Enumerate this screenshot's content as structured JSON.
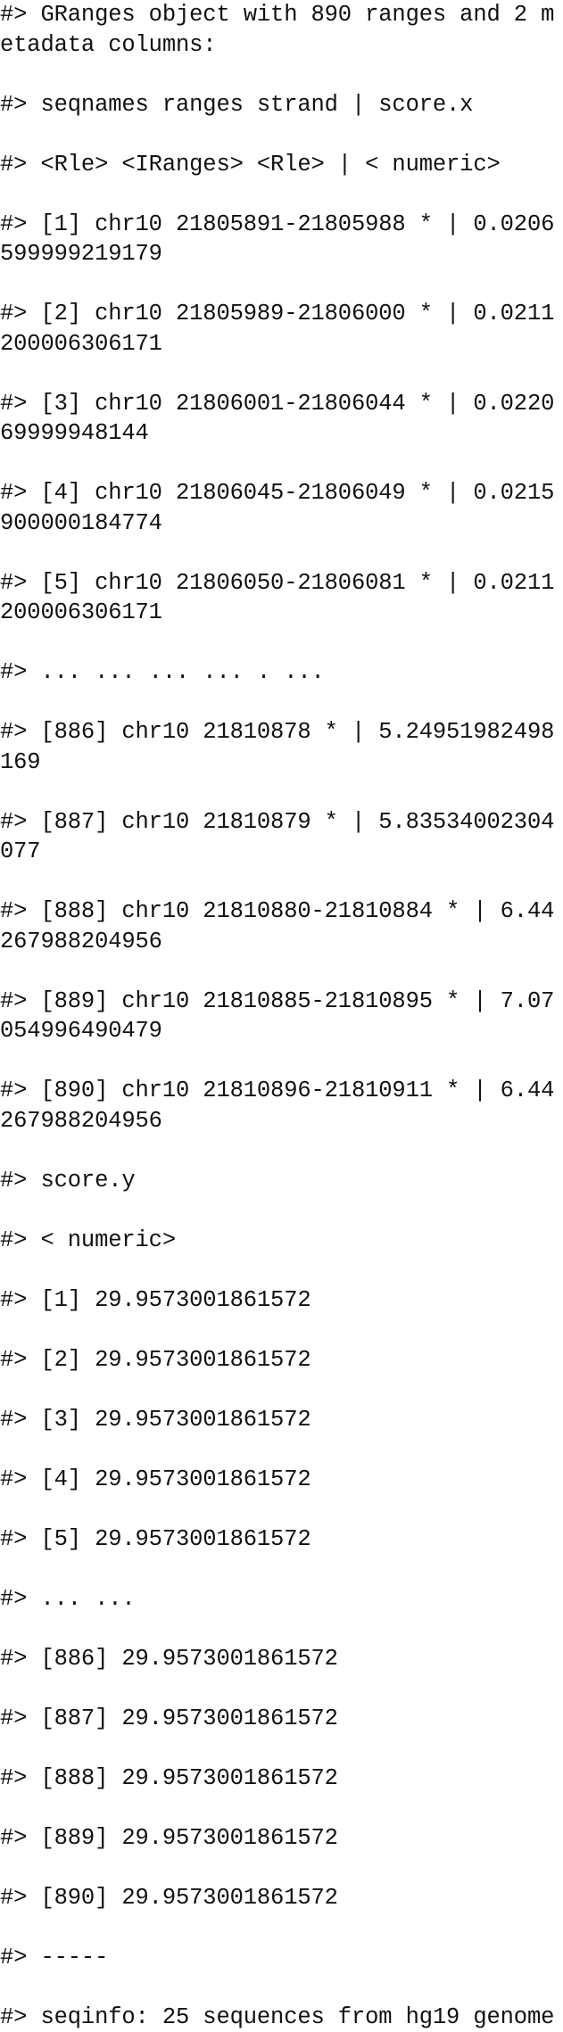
{
  "window": {
    "kind": "r-console-output",
    "background_color": "#ffffff",
    "text_color": "#111111",
    "prompt_prefix": "#>"
  },
  "console": {
    "object_type": "GRanges",
    "n_ranges": 890,
    "n_metadata_columns": 2,
    "genome": "hg19",
    "n_sequences": 25,
    "seqname": "chr10",
    "lines": [
      "#> GRanges object with 890 ranges and 2 metadata columns:",
      "#> seqnames ranges strand | score.x",
      "#> <Rle> <IRanges> <Rle> | < numeric>",
      "#> [1] chr10 21805891-21805988 * | 0.0206599999219179",
      "#> [2] chr10 21805989-21806000 * | 0.0211200006306171",
      "#> [3] chr10 21806001-21806044 * | 0.022069999948144",
      "#> [4] chr10 21806045-21806049 * | 0.0215900000184774",
      "#> [5] chr10 21806050-21806081 * | 0.0211200006306171",
      "#> ... ... ... ... . ...",
      "#> [886] chr10 21810878 * | 5.24951982498169",
      "#> [887] chr10 21810879 * | 5.83534002304077",
      "#> [888] chr10 21810880-21810884 * | 6.44267988204956",
      "#> [889] chr10 21810885-21810895 * | 7.07054996490479",
      "#> [890] chr10 21810896-21810911 * | 6.44267988204956",
      "#> score.y",
      "#> < numeric>",
      "#> [1] 29.9573001861572",
      "#> [2] 29.9573001861572",
      "#> [3] 29.9573001861572",
      "#> [4] 29.9573001861572",
      "#> [5] 29.9573001861572",
      "#> ... ...",
      "#> [886] 29.9573001861572",
      "#> [887] 29.9573001861572",
      "#> [888] 29.9573001861572",
      "#> [889] 29.9573001861572",
      "#> [890] 29.9573001861572",
      "#> -----",
      "#> seqinfo: 25 sequences from hg19 genome"
    ],
    "columns": {
      "seqnames": "seqnames",
      "ranges": "ranges",
      "strand": "strand",
      "separator": "|",
      "score_x": "score.x",
      "score_y": "score.y"
    },
    "column_types": {
      "seqnames": "<Rle>",
      "ranges": "<IRanges>",
      "strand": "<Rle>",
      "score_x": "< numeric>",
      "score_y": "< numeric>"
    },
    "rows_score_x": [
      {
        "index": "[1]",
        "seqnames": "chr10",
        "ranges": "21805891-21805988",
        "strand": "*",
        "score": "0.0206599999219179"
      },
      {
        "index": "[2]",
        "seqnames": "chr10",
        "ranges": "21805989-21806000",
        "strand": "*",
        "score": "0.0211200006306171"
      },
      {
        "index": "[3]",
        "seqnames": "chr10",
        "ranges": "21806001-21806044",
        "strand": "*",
        "score": "0.022069999948144"
      },
      {
        "index": "[4]",
        "seqnames": "chr10",
        "ranges": "21806045-21806049",
        "strand": "*",
        "score": "0.0215900000184774"
      },
      {
        "index": "[5]",
        "seqnames": "chr10",
        "ranges": "21806050-21806081",
        "strand": "*",
        "score": "0.0211200006306171"
      },
      {
        "index": "...",
        "seqnames": "...",
        "ranges": "...",
        "strand": ".",
        "score": "..."
      },
      {
        "index": "[886]",
        "seqnames": "chr10",
        "ranges": "21810878",
        "strand": "*",
        "score": "5.24951982498169"
      },
      {
        "index": "[887]",
        "seqnames": "chr10",
        "ranges": "21810879",
        "strand": "*",
        "score": "5.83534002304077"
      },
      {
        "index": "[888]",
        "seqnames": "chr10",
        "ranges": "21810880-21810884",
        "strand": "*",
        "score": "6.44267988204956"
      },
      {
        "index": "[889]",
        "seqnames": "chr10",
        "ranges": "21810885-21810895",
        "strand": "*",
        "score": "7.07054996490479"
      },
      {
        "index": "[890]",
        "seqnames": "chr10",
        "ranges": "21810896-21810911",
        "strand": "*",
        "score": "6.44267988204956"
      }
    ],
    "rows_score_y": [
      {
        "index": "[1]",
        "score": "29.9573001861572"
      },
      {
        "index": "[2]",
        "score": "29.9573001861572"
      },
      {
        "index": "[3]",
        "score": "29.9573001861572"
      },
      {
        "index": "[4]",
        "score": "29.9573001861572"
      },
      {
        "index": "[5]",
        "score": "29.9573001861572"
      },
      {
        "index": "...",
        "score": "..."
      },
      {
        "index": "[886]",
        "score": "29.9573001861572"
      },
      {
        "index": "[887]",
        "score": "29.9573001861572"
      },
      {
        "index": "[888]",
        "score": "29.9573001861572"
      },
      {
        "index": "[889]",
        "score": "29.9573001861572"
      },
      {
        "index": "[890]",
        "score": "29.9573001861572"
      }
    ],
    "footer": {
      "divider": "-----",
      "seqinfo": "seqinfo: 25 sequences from hg19 genome"
    }
  }
}
